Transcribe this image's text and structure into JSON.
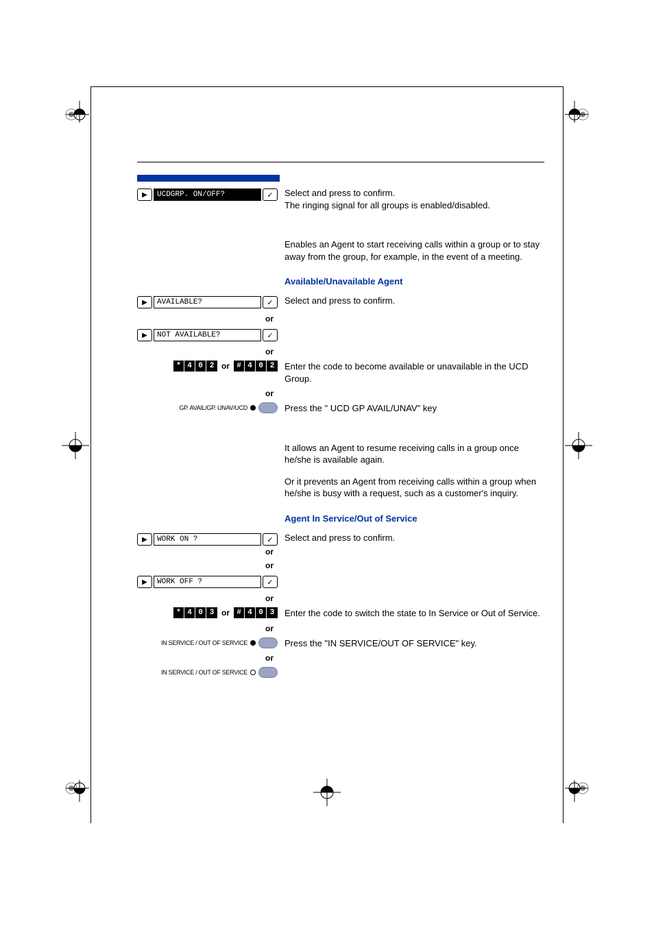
{
  "step_header": {
    "bar": true
  },
  "rows": [
    {
      "type": "display",
      "lcd": "UCDGRP. ON/OFF?",
      "lcd_inverted": true,
      "desc": "Select and press to confirm.\nThe ringing signal for all groups is enabled/disabled."
    },
    {
      "type": "spacer"
    },
    {
      "type": "text",
      "desc": "Enables an Agent to start receiving calls within a group or to stay away from the group, for example, in the event of a meeting."
    },
    {
      "type": "heading",
      "desc": "Available/Unavailable Agent"
    },
    {
      "type": "display",
      "lcd": "AVAILABLE?",
      "desc": "Select and press to confirm."
    },
    {
      "type": "or"
    },
    {
      "type": "display",
      "lcd": "NOT AVAILABLE?",
      "desc": ""
    },
    {
      "type": "or"
    },
    {
      "type": "code",
      "codes_a": [
        "*",
        "4",
        "0",
        "2"
      ],
      "codes_b": [
        "#",
        "4",
        "0",
        "2"
      ],
      "or_label": "or",
      "desc": "Enter the code to become available or unavailable in the UCD Group."
    },
    {
      "type": "or"
    },
    {
      "type": "key",
      "key_label": "GP. AVAIL/GP. UNAV/UCD",
      "led_on": true,
      "desc": "Press the \" UCD GP AVAIL/UNAV\" key"
    },
    {
      "type": "spacer"
    },
    {
      "type": "text",
      "desc": "It allows an Agent to resume receiving calls in a group once he/she is available again."
    },
    {
      "type": "text",
      "desc": "Or it prevents an Agent from receiving calls within a group when he/she is busy with a request, such as a customer's inquiry."
    },
    {
      "type": "heading",
      "desc": "Agent In Service/Out of Service"
    },
    {
      "type": "display_tight",
      "lcd": "WORK ON ?",
      "desc": "Select and press to confirm."
    },
    {
      "type": "or"
    },
    {
      "type": "display",
      "lcd": "WORK OFF ?",
      "desc": ""
    },
    {
      "type": "or"
    },
    {
      "type": "code",
      "codes_a": [
        "*",
        "4",
        "0",
        "3"
      ],
      "codes_b": [
        "#",
        "4",
        "0",
        "3"
      ],
      "or_label": "or",
      "desc": "Enter the code to switch the state to In Service or Out of Service."
    },
    {
      "type": "or"
    },
    {
      "type": "key",
      "key_label": "IN SERVICE / OUT OF SERVICE",
      "led_on": true,
      "desc": "Press the \"IN SERVICE/OUT OF SERVICE\" key."
    },
    {
      "type": "or"
    },
    {
      "type": "key",
      "key_label": "IN SERVICE / OUT OF SERVICE",
      "led_on": false,
      "desc": ""
    }
  ],
  "marks": {
    "note": "registration marks"
  }
}
